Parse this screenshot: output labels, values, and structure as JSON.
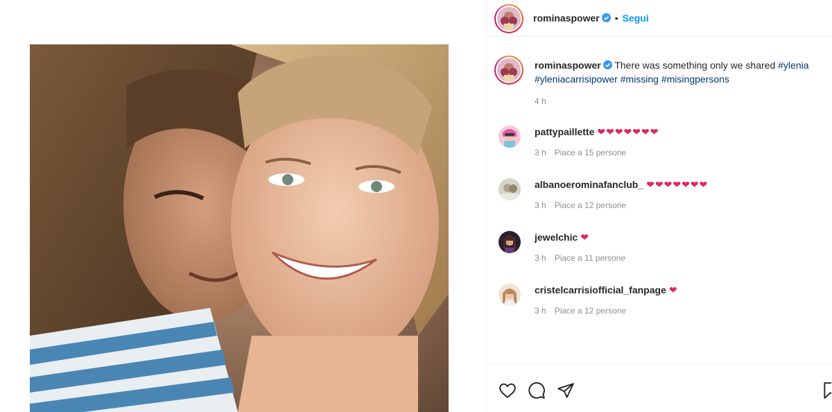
{
  "post": {
    "author": "rominaspower",
    "follow_label": "Segui",
    "separator": "•",
    "caption_text": "There was something only we shared",
    "hashtags": [
      "#ylenia",
      "#yleniacarrisipower",
      "#missing",
      "#misingpersons"
    ],
    "time": "4 h"
  },
  "comments": [
    {
      "user": "pattypaillette",
      "hearts": "❤❤❤❤❤❤❤",
      "time": "3 h",
      "likes": "Piace a 15 persone"
    },
    {
      "user": "albanoerominafanclub_",
      "hearts": "❤❤❤❤❤❤❤",
      "time": "3 h",
      "likes": "Piace a 12 persone"
    },
    {
      "user": "jewelchic",
      "hearts": "❤",
      "time": "3 h",
      "likes": "Piace a 11 persone"
    },
    {
      "user": "cristelcarrisiofficial_fanpage",
      "hearts": "❤",
      "time": "3 h",
      "likes": "Piace a 12 persone"
    }
  ],
  "icons": {
    "like": "heart-outline-icon",
    "comment": "comment-bubble-icon",
    "share": "paper-plane-icon",
    "save": "bookmark-icon",
    "verified": "verified-badge-icon"
  },
  "colors": {
    "link_blue": "#0095f6",
    "hashtag": "#00376b",
    "meta_gray": "#8e8e8e",
    "heart_red": "#e0245e",
    "verified_blue": "#3897f0"
  }
}
